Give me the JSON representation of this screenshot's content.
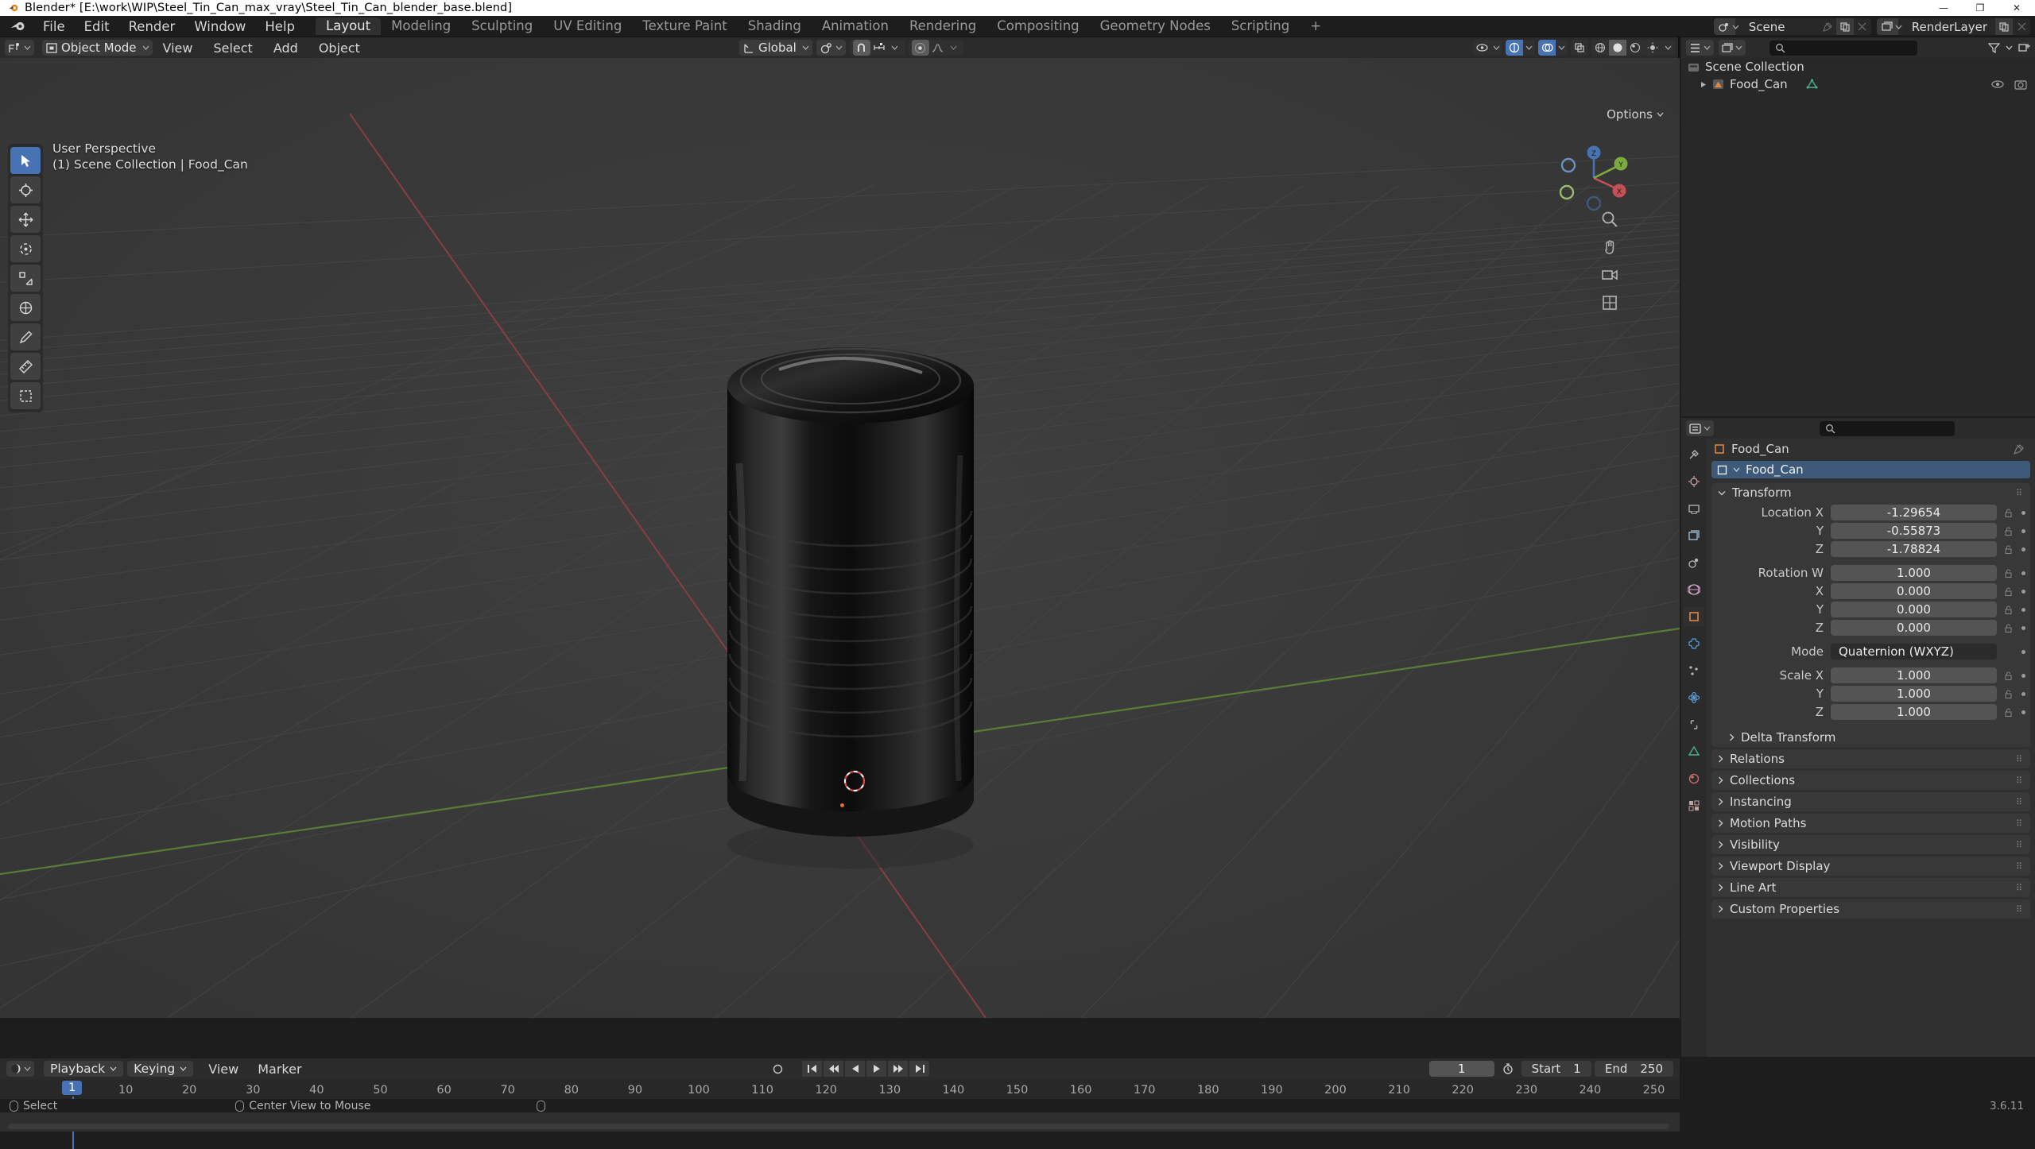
{
  "window": {
    "title": "Blender* [E:\\work\\WIP\\Steel_Tin_Can_max_vray\\Steel_Tin_Can_blender_base.blend]",
    "minimize": "—",
    "maximize": "❐",
    "close": "✕"
  },
  "topbar": {
    "menus": [
      "File",
      "Edit",
      "Render",
      "Window",
      "Help"
    ],
    "workspaces": [
      {
        "label": "Layout",
        "active": true
      },
      {
        "label": "Modeling",
        "active": false
      },
      {
        "label": "Sculpting",
        "active": false
      },
      {
        "label": "UV Editing",
        "active": false
      },
      {
        "label": "Texture Paint",
        "active": false
      },
      {
        "label": "Shading",
        "active": false
      },
      {
        "label": "Animation",
        "active": false
      },
      {
        "label": "Rendering",
        "active": false
      },
      {
        "label": "Compositing",
        "active": false
      },
      {
        "label": "Geometry Nodes",
        "active": false
      },
      {
        "label": "Scripting",
        "active": false
      },
      {
        "label": "+",
        "active": false
      }
    ],
    "scene": {
      "name": "Scene",
      "icon": "scene-icon"
    },
    "view_layer": {
      "name": "RenderLayer",
      "icon": "renderlayer-icon"
    }
  },
  "viewport": {
    "mode": "Object Mode",
    "menus": [
      "View",
      "Select",
      "Add",
      "Object"
    ],
    "transform_orientation": "Global",
    "options_label": "Options",
    "info_line1": "User Perspective",
    "info_line2": "(1) Scene Collection | Food_Can",
    "gizmo_axes": {
      "x": "X",
      "y": "Y",
      "z": "Z"
    },
    "tools": [
      "tweak-select-tool",
      "cursor-tool",
      "move-tool",
      "rotate-tool",
      "scale-tool",
      "transform-tool",
      "annotate-tool",
      "measure-tool",
      "add-cube-tool"
    ]
  },
  "outliner": {
    "search_placeholder": "",
    "rows": [
      {
        "label": "Scene Collection",
        "icon": "collection-icon",
        "depth": 0,
        "expandable": false
      },
      {
        "label": "Food_Can",
        "icon": "object-mesh-icon",
        "depth": 1,
        "expandable": true
      }
    ]
  },
  "properties": {
    "search_placeholder": "",
    "breadcrumb_object": "Food_Can",
    "object_name": "Food_Can",
    "tabs": [
      "tool-tab",
      "render-tab",
      "output-tab",
      "view-layer-tab",
      "scene-tab",
      "world-tab",
      "object-tab",
      "modifiers-tab",
      "particles-tab",
      "physics-tab",
      "constraints-tab",
      "object-data-tab",
      "material-tab",
      "texture-tab"
    ],
    "transform": {
      "title": "Transform",
      "rows": [
        {
          "label": "Location X",
          "value": "-1.29654"
        },
        {
          "label": "Y",
          "value": "-0.55873"
        },
        {
          "label": "Z",
          "value": "-1.78824"
        }
      ],
      "rotation": [
        {
          "label": "Rotation W",
          "value": "1.000"
        },
        {
          "label": "X",
          "value": "0.000"
        },
        {
          "label": "Y",
          "value": "0.000"
        },
        {
          "label": "Z",
          "value": "0.000"
        }
      ],
      "mode_label": "Mode",
      "mode_value": "Quaternion (WXYZ)",
      "scale": [
        {
          "label": "Scale X",
          "value": "1.000"
        },
        {
          "label": "Y",
          "value": "1.000"
        },
        {
          "label": "Z",
          "value": "1.000"
        }
      ],
      "delta_transform": "Delta Transform"
    },
    "panels": [
      "Relations",
      "Collections",
      "Instancing",
      "Motion Paths",
      "Visibility",
      "Viewport Display",
      "Line Art",
      "Custom Properties"
    ]
  },
  "timeline": {
    "menus": [
      "View",
      "Marker"
    ],
    "playback": "Playback",
    "keying": "Keying",
    "current_frame": "1",
    "start_label": "Start",
    "start_value": "1",
    "end_label": "End",
    "end_value": "250",
    "ticks": [
      "1",
      "10",
      "20",
      "30",
      "40",
      "50",
      "60",
      "70",
      "80",
      "90",
      "100",
      "110",
      "120",
      "130",
      "140",
      "150",
      "160",
      "170",
      "180",
      "190",
      "200",
      "210",
      "220",
      "230",
      "240",
      "250"
    ],
    "playhead_frame": "1"
  },
  "statusbar": {
    "select": "Select",
    "center_view": "Center View to Mouse",
    "version": "3.6.11"
  },
  "colors": {
    "accent": "#4772b3",
    "axis_x": "#c44f56",
    "axis_y": "#7bab3e",
    "axis_z": "#4772b3",
    "viewport_bg": "#393939",
    "header_bg": "#2b2b2b",
    "panel_bg": "#303030"
  }
}
